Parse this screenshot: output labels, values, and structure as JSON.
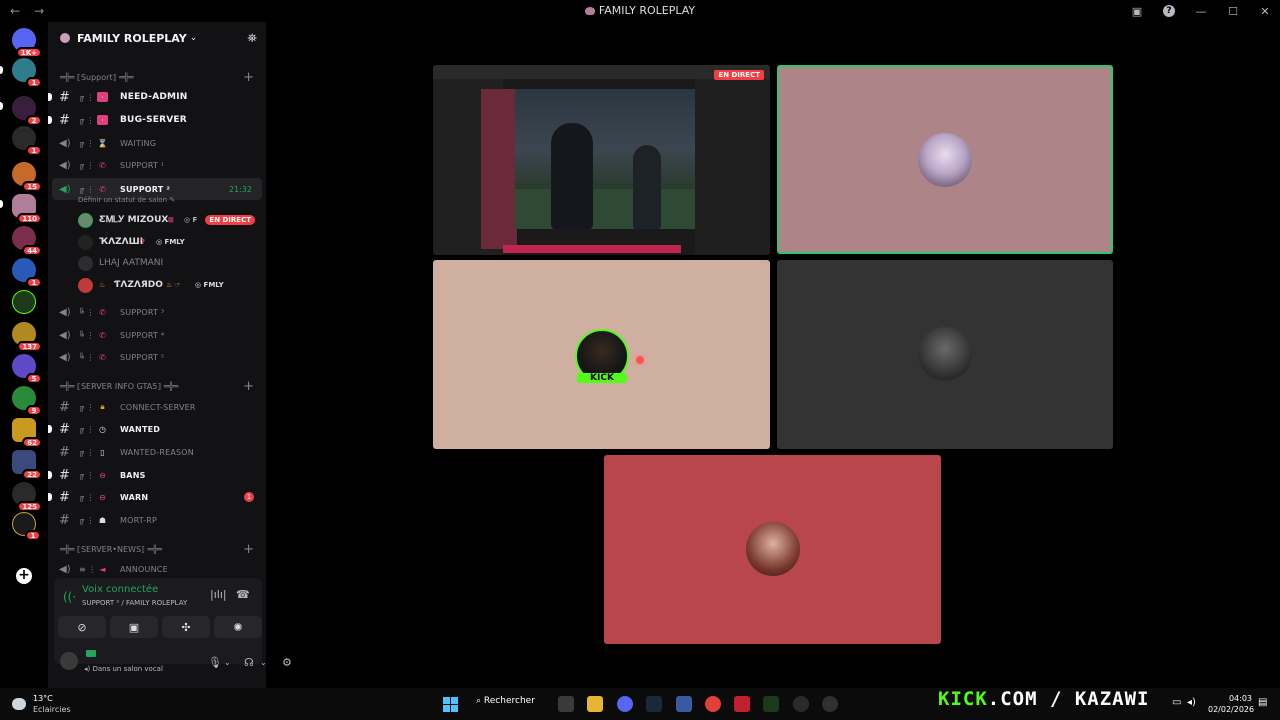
{
  "window": {
    "title": "FAMILY ROLEPLAY"
  },
  "server": {
    "name": "FAMILY ROLEPLAY"
  },
  "rail": {
    "badges": [
      "1K+",
      "1",
      "2",
      "1",
      "15",
      "110",
      "44",
      "1",
      "137",
      "5",
      "9",
      "62",
      "22",
      "125",
      "1"
    ]
  },
  "channels": {
    "cat_support": "═╬═ ⟦Support⟧ ═╬═",
    "need_admin": "NEED-ADMIN",
    "bug_server": "BUG-SERVER",
    "waiting": "WAITING",
    "support1": "SUPPORT ¹",
    "support2": "SUPPORT ²",
    "support2_time": "21:32",
    "support2_status": "Définir un statut de salon",
    "support3": "SUPPORT ³",
    "support4": "SUPPORT ⁴",
    "support5": "SUPPORT ⁵",
    "cat_info": "═╬═ ⟦SERVER INFO GTA5⟧ ═╬═",
    "connect_server": "CONNECT-SERVER",
    "wanted": "WANTED",
    "wanted_reason": "WANTED-REASON",
    "bans": "BANS",
    "warn": "WARN",
    "warn_badge": "1",
    "mort_rp": "MORT-RP",
    "cat_news": "═╬═ ⟦SERVER•NEWS⟧ ═╬═",
    "announce": "ANNOUNCE"
  },
  "voice_users": [
    {
      "name": "ƸᎷᏞᎩ MIZOUX",
      "live": "EN DIRECT"
    },
    {
      "name": "ҠΛZΛШI",
      "tag": "FMLY"
    },
    {
      "name": "LHAJ AATMANI"
    },
    {
      "name": "ƬΛZΛЯDO",
      "tag": "FMLY"
    }
  ],
  "voice_panel": {
    "title": "Voix connectée",
    "subtitle": "SUPPORT ² / FAMILY ROLEPLAY"
  },
  "user_panel": {
    "status": "Dans un salon vocal"
  },
  "stream": {
    "live_label": "EN DIRECT",
    "kick_label": "KICK"
  },
  "taskbar": {
    "temperature": "13°C",
    "condition": "Eclaircies",
    "search_label": "Rechercher",
    "banner_kick": "KICK",
    "banner_rest": ".COM / KAZAWI",
    "time": "04:03",
    "date": "02/02/2026"
  },
  "colors": {
    "accent_green": "#23a55a",
    "kick_green": "#53fc18",
    "live_red": "#f23f43"
  }
}
